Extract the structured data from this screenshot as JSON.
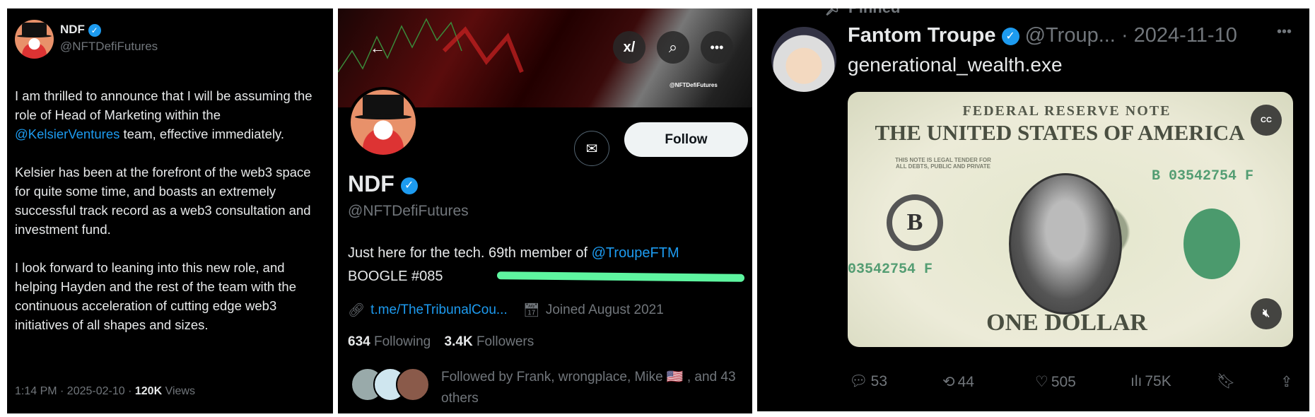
{
  "tweet": {
    "display_name": "NDF",
    "handle": "@NFTDefiFutures",
    "body": [
      {
        "pre": "I am thrilled to announce that I will be assuming the role of Head of Marketing within the ",
        "mention": "@KelsierVentures",
        "post": " team, effective immediately."
      },
      {
        "pre": "Kelsier has been at the forefront of the web3 space for quite some time, and boasts an extremely successful track record as a web3 consultation and investment fund."
      },
      {
        "pre": "I look forward to leaning into this new role, and helping Hayden and the rest of the team with the continuous acceleration of cutting edge web3 initiatives of all shapes and sizes."
      }
    ],
    "time": "1:14 PM · 2025-02-10 · ",
    "views_count": "120K",
    "views_label": " Views"
  },
  "profile": {
    "banner_watermark": "@NFTDefiFutures",
    "follow_label": "Follow",
    "display_name": "NDF",
    "handle": "@NFTDefiFutures",
    "bio_pre": "Just here for the tech. 69th member of ",
    "bio_mention": "@TroupeFTM",
    "bio_line2": "BOOGLE #085",
    "highlight_color": "#5ef5a0",
    "link": "t.me/TheTribunalCou...",
    "joined": "Joined August 2021",
    "following_count": "634",
    "following_label": "Following",
    "followers_count": "3.4K",
    "followers_label": "Followers",
    "followed_by": "Followed by Frank, wrongplace, Mike 🇺🇸 , and 43 others"
  },
  "pinned": {
    "label": "Pinned",
    "display_name": "Fantom Troupe",
    "handle": "@Troup...",
    "date": "· 2024-11-10",
    "text": "generational_wealth.exe",
    "media_lettering": {
      "top": "FEDERAL RESERVE NOTE",
      "title": "THE UNITED STATES OF AMERICA",
      "legal": "THIS NOTE IS LEGAL TENDER FOR ALL DEBTS, PUBLIC AND PRIVATE",
      "serial": "B 03542754 F",
      "serial2": "03542754 F",
      "bottom": "ONE DOLLAR",
      "seal": "B"
    },
    "cc_label": "CC",
    "replies": "53",
    "reposts": "44",
    "likes": "505",
    "views": "75K"
  },
  "colors": {
    "accent": "#1d9bf0",
    "background": "#000000",
    "muted": "#71767b"
  }
}
